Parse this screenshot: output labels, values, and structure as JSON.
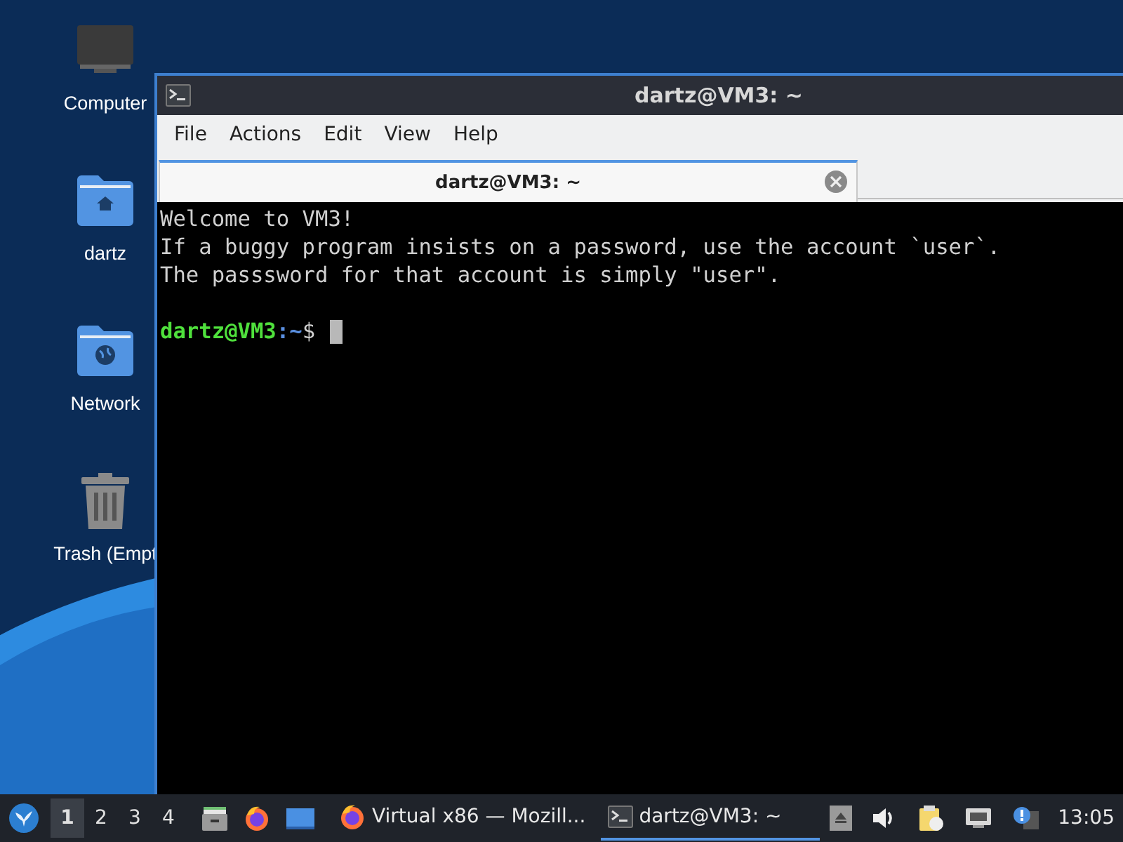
{
  "desktop_icons": [
    {
      "kind": "computer",
      "label": "Computer"
    },
    {
      "kind": "home",
      "label": "dartz"
    },
    {
      "kind": "network",
      "label": "Network"
    },
    {
      "kind": "trash",
      "label": "Trash (Empt"
    }
  ],
  "window": {
    "title": "dartz@VM3: ~",
    "menu": [
      "File",
      "Actions",
      "Edit",
      "View",
      "Help"
    ],
    "tabs": [
      {
        "label": "dartz@VM3: ~",
        "selected": true
      }
    ],
    "terminal": {
      "lines": [
        "Welcome to VM3!",
        "If a buggy program insists on a password, use the account `user`.",
        "The passsword for that account is simply \"user\"."
      ],
      "prompt": {
        "user_host": "dartz@VM3",
        "path": ":~",
        "symbol": "$"
      }
    }
  },
  "taskbar": {
    "workspaces": [
      {
        "label": "1",
        "selected": true
      },
      {
        "label": "2",
        "selected": false
      },
      {
        "label": "3",
        "selected": false
      },
      {
        "label": "4",
        "selected": false
      }
    ],
    "launchers": [
      {
        "kind": "files"
      },
      {
        "kind": "browser"
      },
      {
        "kind": "desktop"
      }
    ],
    "tasks": [
      {
        "kind": "browser",
        "label": "Virtual x86 — Mozill...",
        "selected": false
      },
      {
        "kind": "terminal",
        "label": "dartz@VM3: ~",
        "selected": true
      }
    ],
    "tray": [
      {
        "kind": "eject"
      },
      {
        "kind": "volume"
      },
      {
        "kind": "clipboard"
      },
      {
        "kind": "network"
      },
      {
        "kind": "notification"
      }
    ],
    "clock": "13:05"
  }
}
